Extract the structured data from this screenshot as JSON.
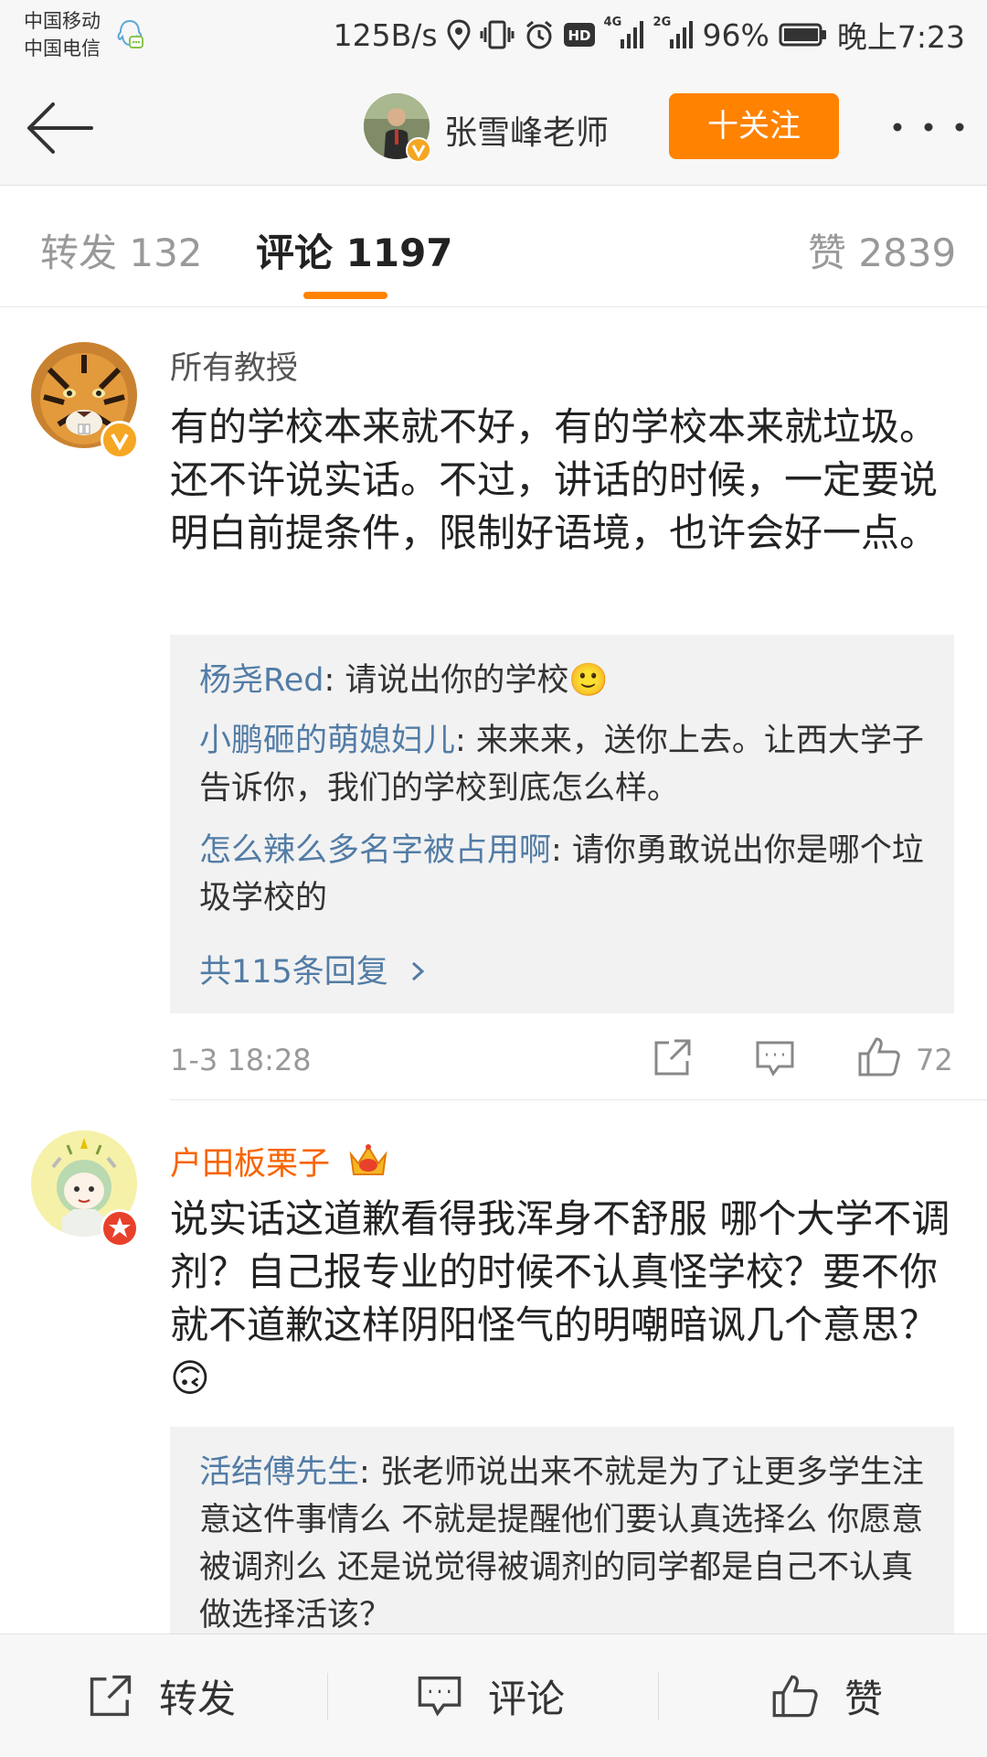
{
  "status_bar": {
    "carrier1": "中国移动",
    "carrier2": "中国电信",
    "speed": "125B/s",
    "net1": "4G",
    "net2": "2G",
    "battery": "96%",
    "time": "晚上7:23"
  },
  "nav": {
    "user_name": "张雪峰老师",
    "follow_label": "十关注"
  },
  "tabs": [
    {
      "label": "转发 132"
    },
    {
      "label": "评论 1197"
    },
    {
      "label": "赞 2839"
    }
  ],
  "comments": [
    {
      "user": "所有教授",
      "text": "有的学校本来就不好，有的学校本来就垃圾。还不许说实话。不过，讲话的时候，一定要说明白前提条件，限制好语境，也许会好一点。",
      "replies": [
        {
          "user": "杨尧Red",
          "text": ": 请说出你的学校🙂"
        },
        {
          "user": "小鹏砸的萌媳妇儿",
          "text": ": 来来来，送你上去。让西大学子告诉你，我们的学校到底怎么样。"
        },
        {
          "user": "怎么辣么多名字被占用啊",
          "text": ": 请你勇敢说出你是哪个垃圾学校的"
        }
      ],
      "more_replies": "共115条回复",
      "time": "1-3 18:28",
      "likes": "72"
    },
    {
      "user": "户田板栗子",
      "text": "说实话这道歉看得我浑身不舒服  哪个大学不调剂？自己报专业的时候不认真怪学校？要不你就不道歉这样阴阳怪气的明嘲暗讽几个意思？🙃",
      "replies": [
        {
          "user": "活结傅先生",
          "text": ": 张老师说出来不就是为了让更多学生注意这件事情么 不就是提醒他们要认真选择么 你愿意被调剂么 还是说觉得被调剂的同学都是自己不认真做选择活该？"
        }
      ]
    }
  ],
  "bottom_bar": {
    "repost": "转发",
    "comment": "评论",
    "like": "赞"
  },
  "colors": {
    "accent": "#ff8200",
    "link": "#527ca6",
    "vip_name": "#f86400"
  }
}
